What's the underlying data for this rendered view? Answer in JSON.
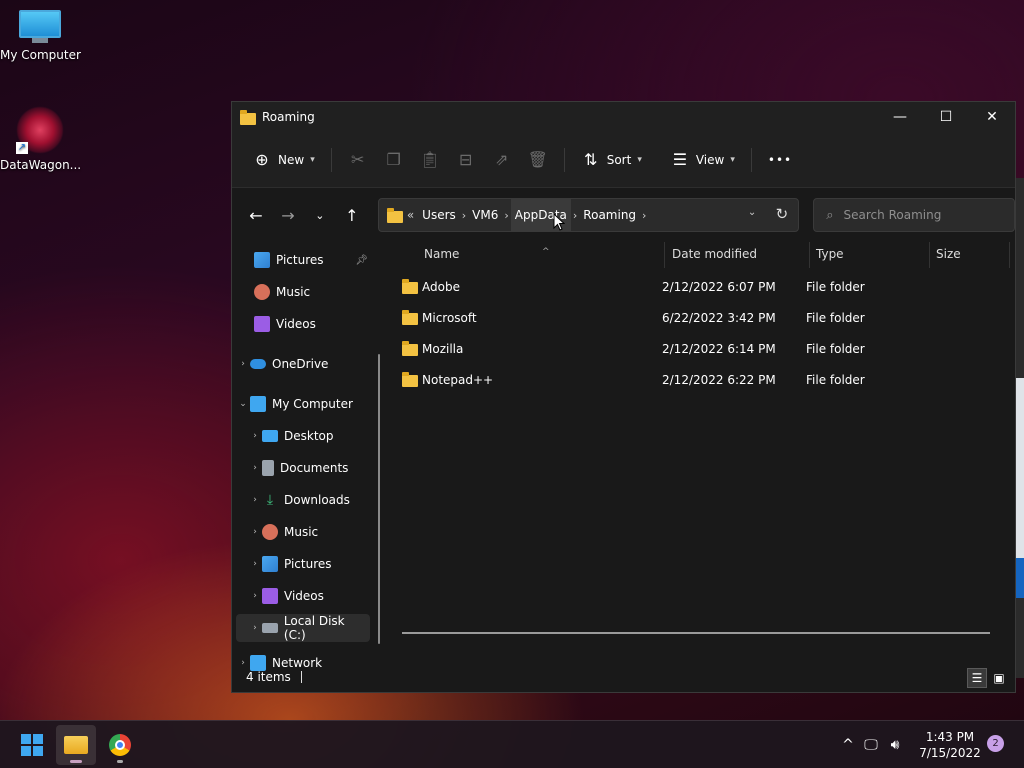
{
  "desktop": {
    "icons": [
      {
        "label": "My Computer"
      },
      {
        "label": "DataWagon..."
      }
    ]
  },
  "window": {
    "title": "Roaming"
  },
  "toolbar": {
    "new_label": "New",
    "sort_label": "Sort",
    "view_label": "View",
    "more_label": "•••"
  },
  "address": {
    "overflow": "«",
    "crumbs": [
      "Users",
      "VM6",
      "AppData",
      "Roaming"
    ]
  },
  "search": {
    "placeholder": "Search Roaming"
  },
  "nav": {
    "items": [
      {
        "label": "Pictures"
      },
      {
        "label": "Music"
      },
      {
        "label": "Videos"
      },
      {
        "label": "OneDrive"
      },
      {
        "label": "My Computer"
      },
      {
        "label": "Desktop"
      },
      {
        "label": "Documents"
      },
      {
        "label": "Downloads"
      },
      {
        "label": "Music"
      },
      {
        "label": "Pictures"
      },
      {
        "label": "Videos"
      },
      {
        "label": "Local Disk (C:)"
      },
      {
        "label": "Network"
      }
    ]
  },
  "columns": {
    "name": "Name",
    "date": "Date modified",
    "type": "Type",
    "size": "Size"
  },
  "files": [
    {
      "name": "Adobe",
      "date": "2/12/2022 6:07 PM",
      "type": "File folder"
    },
    {
      "name": "Microsoft",
      "date": "6/22/2022 3:42 PM",
      "type": "File folder"
    },
    {
      "name": "Mozilla",
      "date": "2/12/2022 6:14 PM",
      "type": "File folder"
    },
    {
      "name": "Notepad++",
      "date": "2/12/2022 6:22 PM",
      "type": "File folder"
    }
  ],
  "status": {
    "items_count": "4 items"
  },
  "taskbar": {
    "time": "1:43 PM",
    "date": "7/15/2022",
    "notification_count": "2"
  },
  "colors": {
    "folder": "#f3c242",
    "window_bg": "#191919",
    "accent": "#3fa7f0"
  }
}
